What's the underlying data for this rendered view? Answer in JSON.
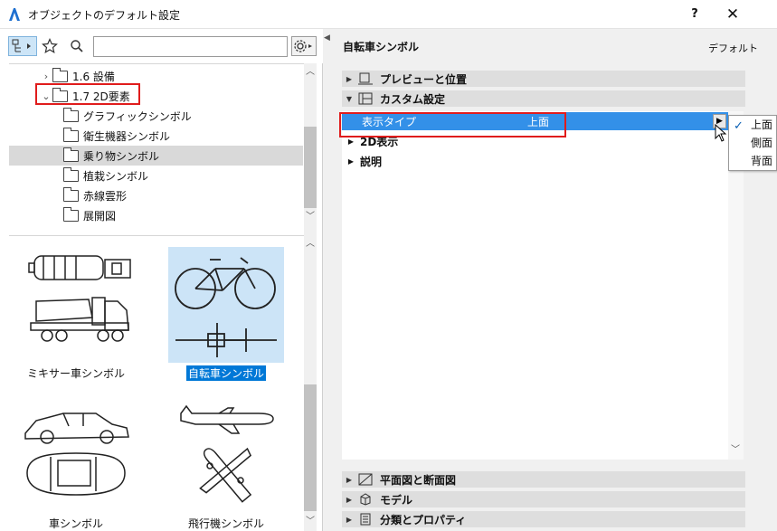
{
  "window": {
    "title": "オブジェクトのデフォルト設定",
    "help": "?",
    "close": "✕",
    "accent": "#0078d7"
  },
  "toolbar": {
    "search_placeholder": "",
    "search_value": ""
  },
  "tree": {
    "items": [
      {
        "label": "1.6 設備",
        "expander": "›"
      },
      {
        "label": "1.7 2D要素",
        "expander": "⌄"
      },
      {
        "label": "グラフィックシンボル"
      },
      {
        "label": "衛生機器シンボル"
      },
      {
        "label": "乗り物シンボル"
      },
      {
        "label": "植栽シンボル"
      },
      {
        "label": "赤線雲形"
      },
      {
        "label": "展開図"
      }
    ]
  },
  "gallery": {
    "items": [
      {
        "label": "ミキサー車シンボル",
        "icon": "mixer-truck-icon"
      },
      {
        "label": "自転車シンボル",
        "icon": "bicycle-icon"
      },
      {
        "label": "車シンボル",
        "icon": "car-icon"
      },
      {
        "label": "飛行機シンボル",
        "icon": "airplane-icon"
      }
    ]
  },
  "settings": {
    "object_name": "自転車シンボル",
    "default_label": "デフォルト",
    "panels": [
      {
        "label": "プレビューと位置"
      },
      {
        "label": "カスタム設定"
      },
      {
        "label": "平面図と断面図"
      },
      {
        "label": "モデル"
      },
      {
        "label": "分類とプロパティ"
      }
    ],
    "params": {
      "display_type": {
        "name": "表示タイプ",
        "value": "上面"
      },
      "groups": [
        {
          "label": "2D表示"
        },
        {
          "label": "説明"
        }
      ]
    }
  },
  "dropdown": {
    "options": [
      {
        "label": "上面",
        "checked": true
      },
      {
        "label": "側面",
        "checked": false
      },
      {
        "label": "背面",
        "checked": false
      }
    ]
  }
}
